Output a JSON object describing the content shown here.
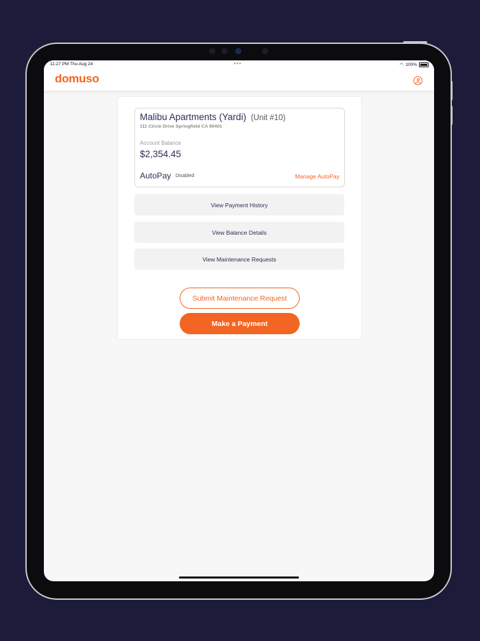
{
  "status_bar": {
    "time": "11:27 PM  Thu Aug 24",
    "dots": "•••",
    "battery": "100%",
    "wifi_icon": "wifi-icon"
  },
  "app": {
    "logo": "domuso",
    "brand_color": "#f26522",
    "profile_icon": "user-circle-icon"
  },
  "property": {
    "name": "Malibu Apartments (Yardi)",
    "unit": "(Unit #10)",
    "address": "111 Circle Drive Springfield CA 90401",
    "balance_label": "Account Balance",
    "balance_value": "$2,354.45",
    "autopay_label": "AutoPay",
    "autopay_status": "Disabled",
    "manage_autopay": "Manage AutoPay"
  },
  "actions": [
    {
      "label": "View Payment History"
    },
    {
      "label": "View Balance Details"
    },
    {
      "label": "View Maintenance Requests"
    }
  ],
  "buttons": {
    "submit_maintenance": "Submit Maintenance Request",
    "make_payment": "Make a Payment"
  }
}
